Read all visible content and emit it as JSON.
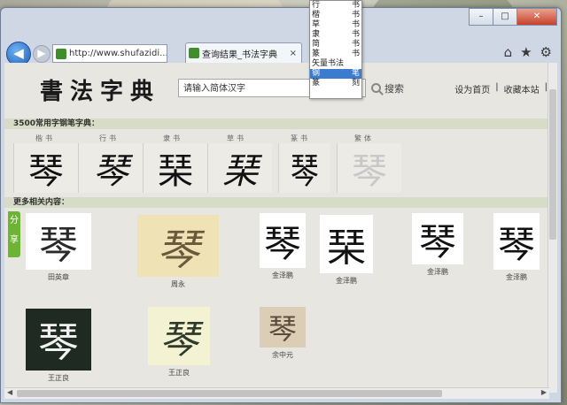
{
  "browser": {
    "url": "http://www.shufazidi...",
    "tab_title": "查询结果_书法字典",
    "tab_close": "×",
    "back": "◀",
    "forward": "▶",
    "search_sym": "⚲",
    "refresh_sym": "↻"
  },
  "header": {
    "logo": "書法字典",
    "search_placeholder": "请输入简体汉字",
    "search_button": "搜索",
    "link_home": "设为首页",
    "link_fav": "收藏本站",
    "divider": "|"
  },
  "section_common": "3500常用字钢笔字典：",
  "styles": [
    "楷书",
    "行书",
    "隶书",
    "草书",
    "篆书",
    "繁体"
  ],
  "glyphs": [
    "琴",
    "琴",
    "琹",
    "琹",
    "琴",
    "琴"
  ],
  "section_more": "更多相关内容：",
  "share": "分享",
  "samples": [
    {
      "char": "琴",
      "author": "田英章"
    },
    {
      "char": "琴",
      "author": "周永"
    },
    {
      "char": "琴",
      "author": "金泽鹏"
    },
    {
      "char": "琹",
      "author": "金泽鹏"
    },
    {
      "char": "琴",
      "author": "金泽鹏"
    },
    {
      "char": "琴",
      "author": "金泽鹏"
    },
    {
      "char": "琴",
      "author": "王正良"
    },
    {
      "char": "琴",
      "author": "王正良"
    },
    {
      "char": "琴",
      "author": "余中元"
    }
  ],
  "dropdown": [
    {
      "a": "行",
      "b": "书"
    },
    {
      "a": "楷",
      "b": "书"
    },
    {
      "a": "草",
      "b": "书"
    },
    {
      "a": "隶",
      "b": "书"
    },
    {
      "a": "简",
      "b": "书"
    },
    {
      "a": "篆",
      "b": "书"
    },
    {
      "a": "矢量书法",
      "b": ""
    },
    {
      "a": "钢",
      "b": "笔"
    },
    {
      "a": "篆",
      "b": "刻"
    }
  ],
  "colors": {
    "accent": "#3d7bd0",
    "share": "#6db434",
    "section": "#d7dcc6"
  }
}
